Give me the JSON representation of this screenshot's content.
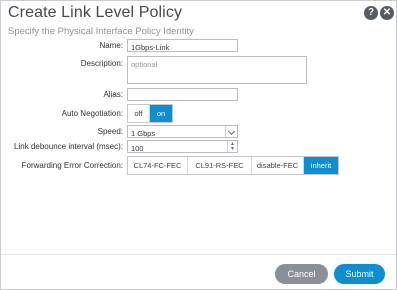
{
  "dialog": {
    "title": "Create Link Level Policy",
    "subtitle": "Specify the Physical Interface Policy Identity"
  },
  "form": {
    "name_label": "Name:",
    "name_value": "1Gbps-Link",
    "description_label": "Description:",
    "description_placeholder": "optional",
    "alias_label": "Alias:",
    "alias_value": "",
    "autoneg_label": "Auto Negotiation:",
    "autoneg_options": [
      "off",
      "on"
    ],
    "autoneg_selected": "on",
    "speed_label": "Speed:",
    "speed_value": "1 Gbps",
    "debounce_label": "Link debounce interval (msec):",
    "debounce_value": "100",
    "fec_label": "Forwarding Error Correction:",
    "fec_options": [
      "CL74-FC-FEC",
      "CL91-RS-FEC",
      "disable-FEC",
      "inherit"
    ],
    "fec_selected": "inherit"
  },
  "footer": {
    "cancel_label": "Cancel",
    "submit_label": "Submit"
  },
  "colors": {
    "accent": "#0b8ed2",
    "cancel": "#8a9096"
  },
  "icons": {
    "help": "help-icon",
    "close": "close-icon"
  }
}
